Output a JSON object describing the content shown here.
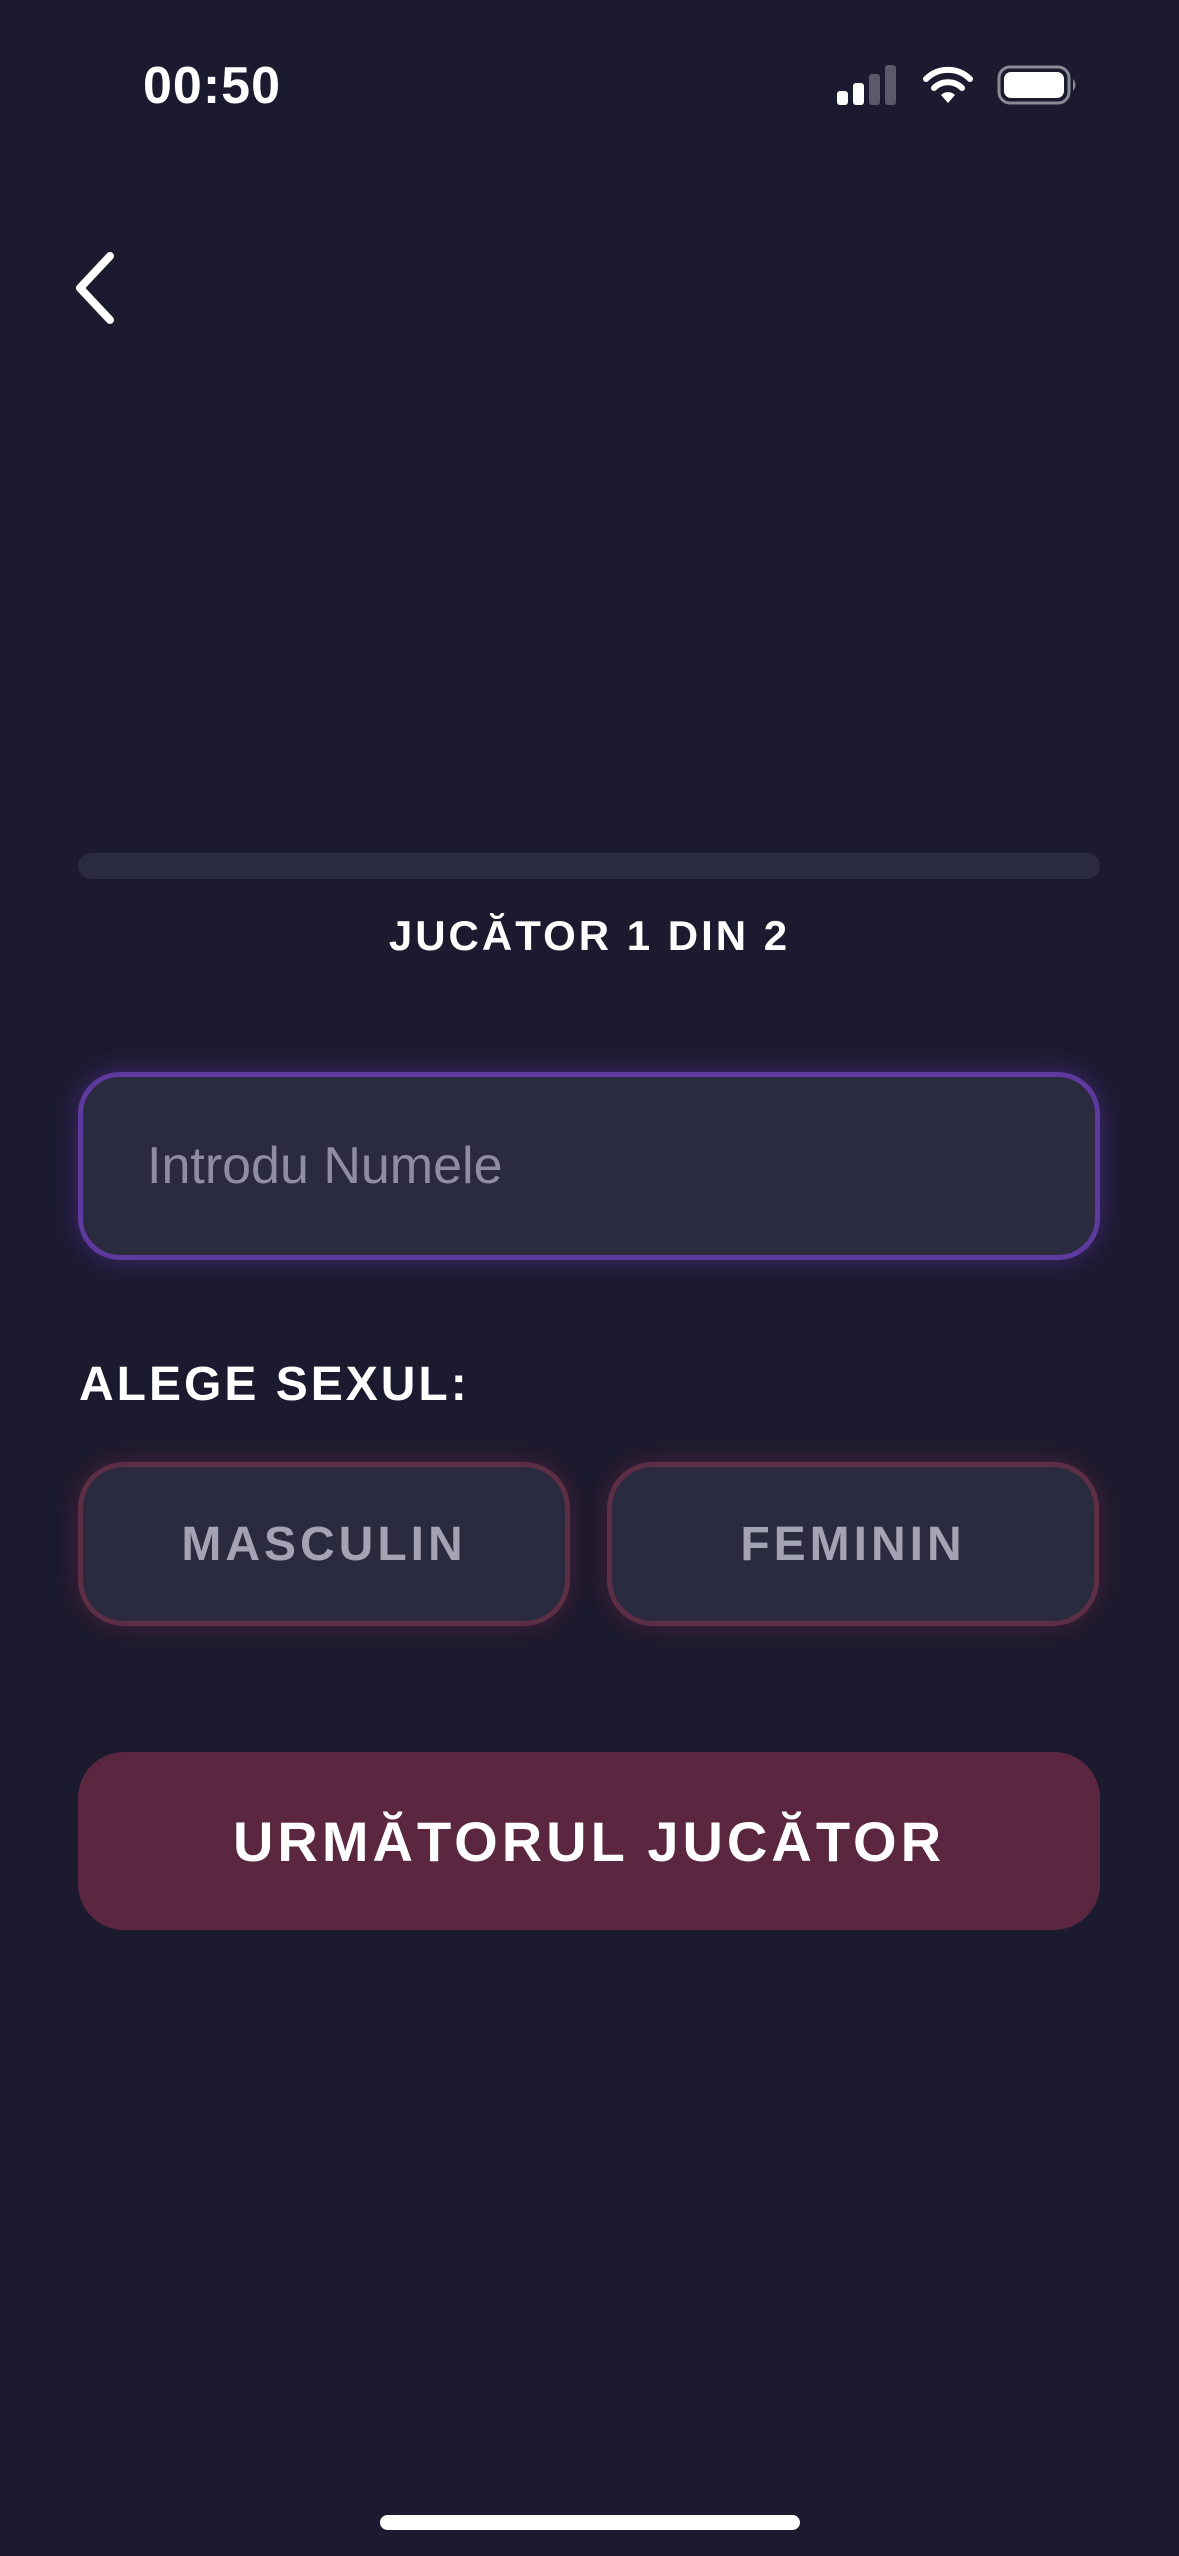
{
  "status_bar": {
    "time": "00:50",
    "signal_icon": "cellular-signal-icon",
    "wifi_icon": "wifi-icon",
    "battery_icon": "battery-icon"
  },
  "header": {
    "back_icon": "chevron-left-icon"
  },
  "progress": {
    "value": 0,
    "label": "JUCĂTOR 1 DIN 2"
  },
  "name_input": {
    "value": "",
    "placeholder": "Introdu Numele"
  },
  "gender": {
    "label": "ALEGE SEXUL:",
    "options": [
      {
        "label": "MASCULIN"
      },
      {
        "label": "FEMININ"
      }
    ]
  },
  "actions": {
    "next_label": "URMĂTORUL JUCĂTOR"
  },
  "colors": {
    "background": "#1b1a2e",
    "accent_purple": "#5e3a9e",
    "accent_red": "#5b2740",
    "surface": "#2b2b40"
  }
}
